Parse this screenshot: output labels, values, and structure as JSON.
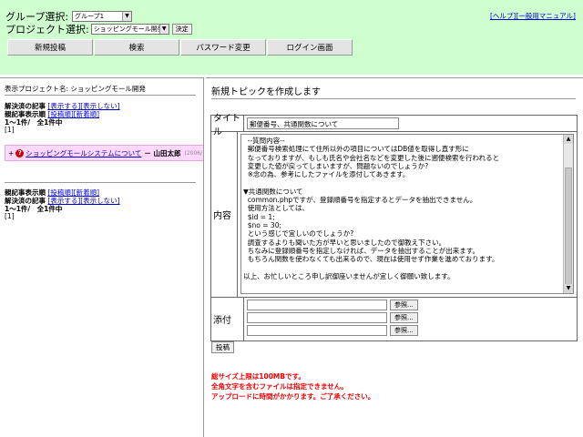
{
  "header": {
    "group_label": "グループ選択:",
    "group_value": "グループ1",
    "project_label": "プロジェクト選択:",
    "project_value": "ショッピングモール開発",
    "decide_button": "決定",
    "help_link": "[ヘルプ]",
    "manual_link": "[一般用マニュアル]"
  },
  "nav": {
    "new_post": "新規投稿",
    "search": "検索",
    "password_change": "パスワード変更",
    "login_screen": "ログイン画面"
  },
  "left": {
    "project_display": "表示プロジェクト名: ショッピングモール開発",
    "section1": {
      "resolved_label": "解決済の記事",
      "show": "[表示する]",
      "hide": "[表示しない]",
      "order_label": "親記事表示順",
      "by_post": "[投稿順]",
      "by_newest": "[新着順]",
      "count": "1〜1件/　全1件中",
      "page": "[1]"
    },
    "topic": {
      "prefix": "+",
      "title": "ショッピングモールシステムについて",
      "author": "－ 山田太郎",
      "date": "(2006/"
    },
    "section2": {
      "order_label": "親記事表示順",
      "by_post": "[投稿順]",
      "by_newest": "[新着順]",
      "resolved_label": "解決済の記事",
      "show": "[表示する]",
      "hide": "[表示しない]",
      "count": "1〜1件/　全1件中",
      "page": "[1]"
    }
  },
  "right": {
    "title": "新規トピックを作成します",
    "form": {
      "title_label": "タイトル",
      "title_value": "郵便番号、共通関数について",
      "content_label": "内容",
      "content_value": "  --質問内容--\n  郵便番号検索処理にて住所以外の項目についてはDB値を取得し直す形に\n  なっておりますが、もしも氏名や会社名などを変更した後に遡便検索を行われると\n  変更した値が戻ってしまいますが、問題ないのでしょうか?\n  ※念の為、参考にしたファイルを添付してあきます。\n\n▼共通関数について\n  common.phpですが、登録順番号を指定するとデータを抽出できません。\n  使用方法としては、\n  $id = 1;\n  $no = 30;\n  という感じで宜しいのでしょうか?\n  調査するよりも聞いた方が早いと思いましたので御教え下さい。\n  ちなみに登録順番号を指定しなければ、データを抽出することが出来ます。\n  もちろん関数を使わなくても出来るので、現在は使用せず作業を進めております。\n\n以上、お忙しいところ申し訳御座いませんが宜しく御願い致します。",
      "attach_label": "添付",
      "browse": "参照..."
    },
    "submit_button": "投稿",
    "notices": [
      "総サイズ上限は100MBです。",
      "全角文字を含むファイルは指定できません。",
      "アップロードに時間がかかります。ご了承ください。"
    ]
  }
}
